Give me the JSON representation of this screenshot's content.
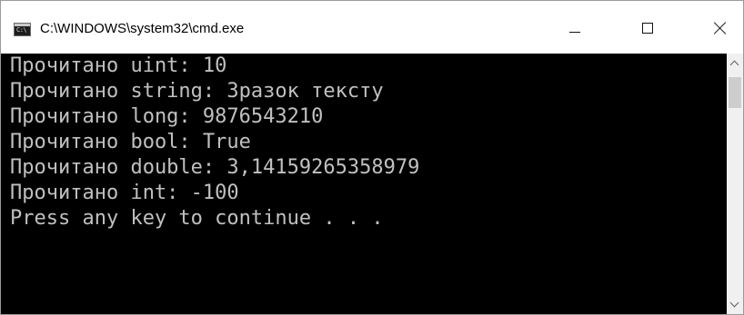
{
  "window": {
    "title": "C:\\WINDOWS\\system32\\cmd.exe",
    "icon": "cmd-icon",
    "icon_text": "C:\\"
  },
  "caption_buttons": {
    "minimize": "minimize-icon",
    "maximize": "maximize-icon",
    "close": "close-icon"
  },
  "console": {
    "background": "#000000",
    "foreground": "#c0c0c0",
    "lines": [
      "Прочитано uint: 10",
      "Прочитано string: Зразок тексту",
      "Прочитано long: 9876543210",
      "Прочитано bool: True",
      "Прочитано double: 3,14159265358979",
      "Прочитано int: -100",
      "Press any key to continue . . ."
    ]
  },
  "scrollbar": {
    "up": "chevron-up-icon",
    "down": "chevron-down-icon"
  }
}
